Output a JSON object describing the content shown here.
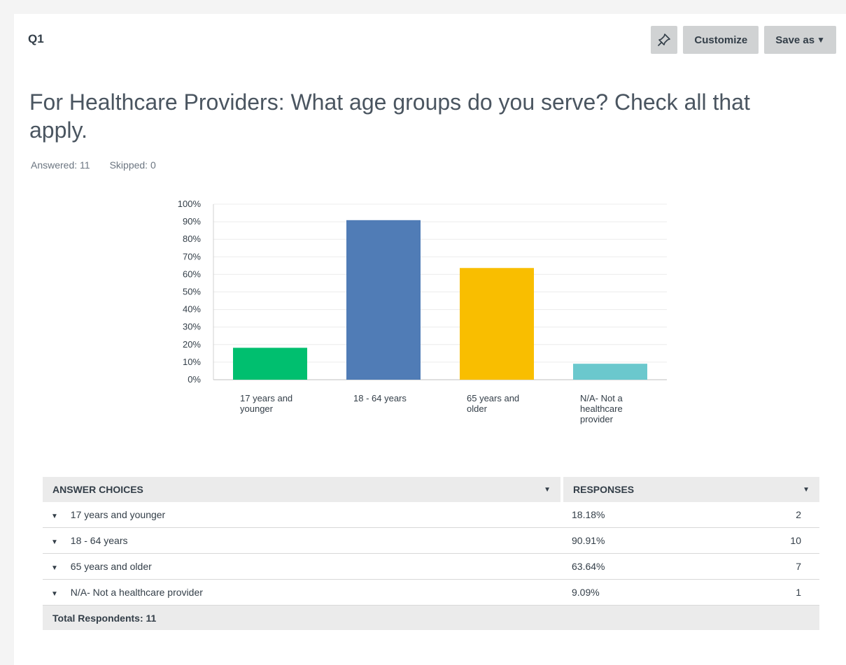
{
  "question": {
    "number": "Q1",
    "text": "For Healthcare Providers: What age groups do you serve? Check all that apply.",
    "answered_label": "Answered: 11",
    "skipped_label": "Skipped: 0"
  },
  "toolbar": {
    "pin_icon": "pin-icon",
    "customize_label": "Customize",
    "save_as_label": "Save as",
    "save_as_caret": "▼"
  },
  "colors": {
    "bar_1": "#00bf6f",
    "bar_2": "#507cb6",
    "bar_3": "#f9be00",
    "bar_4": "#6bc8cd"
  },
  "chart_data": {
    "type": "bar",
    "categories": [
      "17 years and younger",
      "18 - 64 years",
      "65 years and older",
      "N/A- Not a healthcare provider"
    ],
    "category_label_lines": [
      [
        "17 years and",
        "younger"
      ],
      [
        "18 - 64 years"
      ],
      [
        "65 years and",
        "older"
      ],
      [
        "N/A- Not a",
        "healthcare",
        "provider"
      ]
    ],
    "values": [
      18.18,
      90.91,
      63.64,
      9.09
    ],
    "colors": [
      "#00bf6f",
      "#507cb6",
      "#f9be00",
      "#6bc8cd"
    ],
    "y_ticks": [
      "0%",
      "10%",
      "20%",
      "30%",
      "40%",
      "50%",
      "60%",
      "70%",
      "80%",
      "90%",
      "100%"
    ],
    "ylim": [
      0,
      100
    ],
    "grid": true
  },
  "table": {
    "header_choices": "ANSWER CHOICES",
    "header_responses": "RESPONSES",
    "header_caret": "▼",
    "row_caret": "▼",
    "rows": [
      {
        "choice": "17 years and younger",
        "percent": "18.18%",
        "count": "2"
      },
      {
        "choice": "18 - 64 years",
        "percent": "90.91%",
        "count": "10"
      },
      {
        "choice": "65 years and older",
        "percent": "63.64%",
        "count": "7"
      },
      {
        "choice": "N/A- Not a healthcare provider",
        "percent": "9.09%",
        "count": "1"
      }
    ],
    "total_label": "Total Respondents: 11"
  }
}
